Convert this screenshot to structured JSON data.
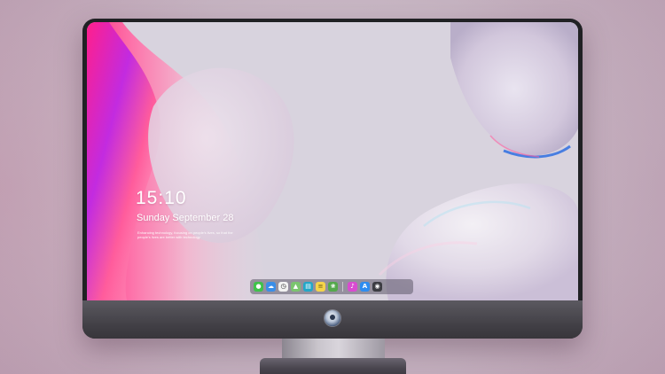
{
  "lockscreen": {
    "time": "15:10",
    "date": "Sunday September 28",
    "notice": "Enhancing technology, focusing on people's lives, so that the people's lives are better with technology"
  },
  "dock": {
    "items": [
      {
        "name": "messages",
        "icon": "chat-bubble-icon",
        "glyph": "●",
        "bg": "#3fc24b"
      },
      {
        "name": "weather",
        "icon": "cloud-icon",
        "glyph": "☁",
        "bg": "#3a8ee8"
      },
      {
        "name": "clock",
        "icon": "clock-icon",
        "glyph": "◷",
        "bg": "#f2f2f2"
      },
      {
        "name": "maps",
        "icon": "map-icon",
        "glyph": "▲",
        "bg": "#7bc46f"
      },
      {
        "name": "media",
        "icon": "film-icon",
        "glyph": "▤",
        "bg": "#23a7c8"
      },
      {
        "name": "notes",
        "icon": "notes-icon",
        "glyph": "≡",
        "bg": "#f4d44a"
      },
      {
        "name": "photos",
        "icon": "photos-icon",
        "glyph": "❀",
        "bg": "#55a94c"
      },
      {
        "name": "music",
        "icon": "music-note-icon",
        "glyph": "♪",
        "bg": "#d94bd0"
      },
      {
        "name": "app-store",
        "icon": "app-store-icon",
        "glyph": "A",
        "bg": "#2e8cf0"
      },
      {
        "name": "camera",
        "icon": "camera-icon",
        "glyph": "◉",
        "bg": "#3c3c42"
      }
    ]
  },
  "colors": {
    "wallpaper_base": "#d6d1dc",
    "accent_pink": "#ff2d8a",
    "accent_purple": "#9b2bd8",
    "accent_blue": "#2a6fe0",
    "bezel": "#202124"
  }
}
